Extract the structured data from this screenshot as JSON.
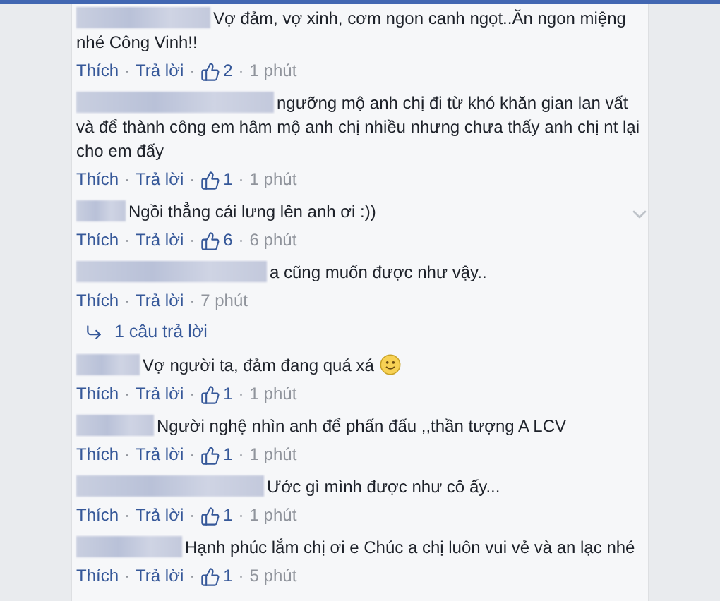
{
  "separator": "·",
  "comments": [
    {
      "text": "Vợ đảm, vợ xinh, cơm ngon canh ngọt..Ăn ngon miệng nhé Công Vinh!!",
      "like": "Thích",
      "reply": "Trả lời",
      "likes": "2",
      "time": "1 phút"
    },
    {
      "text": "ngưỡng mộ anh chị đi từ khó khăn gian lan vất và để thành công em hâm mộ anh chị nhiều nhưng chưa thấy anh chị nt lại cho em đấy",
      "like": "Thích",
      "reply": "Trả lời",
      "likes": "1",
      "time": "1 phút"
    },
    {
      "text": "Ngồi thẳng cái lưng lên anh ơi :))",
      "like": "Thích",
      "reply": "Trả lời",
      "likes": "6",
      "time": "6 phút",
      "menu_shown": true
    },
    {
      "text": "a cũng muốn được như vậy..",
      "like": "Thích",
      "reply": "Trả lời",
      "time": "7 phút",
      "replies_link": "1 câu trả lời"
    },
    {
      "text": "Vợ người ta, đảm đang quá xá",
      "like": "Thích",
      "reply": "Trả lời",
      "likes": "1",
      "time": "1 phút",
      "emoji": true
    },
    {
      "text": "Người nghệ nhìn anh để phấn đấu ,,thần tượng A LCV",
      "like": "Thích",
      "reply": "Trả lời",
      "likes": "1",
      "time": "1 phút"
    },
    {
      "text": "Ước gì mình được như cô ấy...",
      "like": "Thích",
      "reply": "Trả lời",
      "likes": "1",
      "time": "1 phút"
    },
    {
      "text": "Hạnh phúc lắm chị ơi e Chúc a chị luôn vui vẻ và an lạc nhé",
      "like": "Thích",
      "reply": "Trả lời",
      "likes": "1",
      "time": "5 phút"
    }
  ]
}
